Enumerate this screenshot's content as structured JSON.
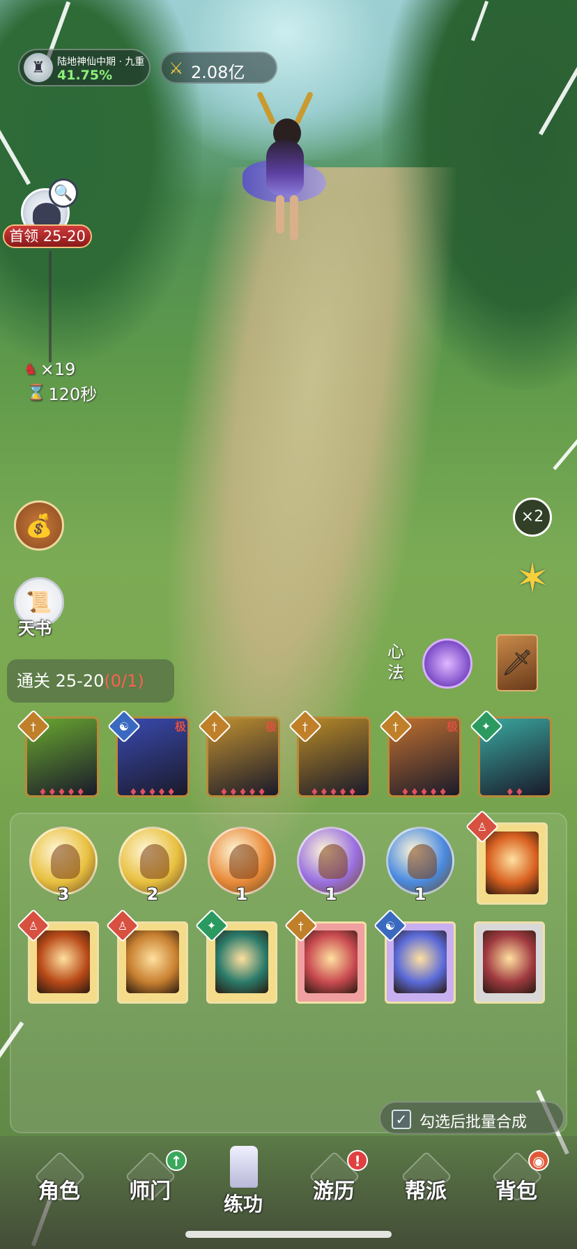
{
  "hud": {
    "rank_title": "陆地神仙中期 · 九重",
    "rank_progress": "41.75%",
    "power_value": "2.08亿",
    "power_icon": "crossed-swords-icon"
  },
  "boss": {
    "label": "首领 25-20",
    "search_icon": "magnifier-icon"
  },
  "wave": {
    "kills": "×19",
    "timer": "120秒",
    "kill_icon": "demon-head-icon",
    "timer_icon": "hourglass-icon"
  },
  "side_left": {
    "bag_icon": "money-bag-icon",
    "book_label": "天书",
    "book_icon": "scroll-icon"
  },
  "side_right": {
    "speed_label": "×2",
    "star_icon": "six-point-star-icon"
  },
  "stage": {
    "prefix": "通关 25-20",
    "count": "(0/1)"
  },
  "xinfa": {
    "label": "心法",
    "icon": "lotus-orb-icon",
    "weapon_icon": "sword-icon"
  },
  "skills": [
    {
      "type": "sword",
      "tag": "",
      "pips": "♦♦♦♦♦",
      "color": "#6aa830"
    },
    {
      "type": "yin-yang",
      "tag": "极",
      "pips": "♦♦♦♦♦",
      "color": "#3a4ab0"
    },
    {
      "type": "sword",
      "tag": "极",
      "pips": "♦♦♦♦♦",
      "color": "#c09030"
    },
    {
      "type": "sword",
      "tag": "",
      "pips": "♦♦♦♦♦",
      "color": "#b88a28"
    },
    {
      "type": "sword",
      "tag": "极",
      "pips": "♦♦♦♦♦",
      "color": "#c07030"
    },
    {
      "type": "leaf",
      "tag": "",
      "pips": "♦♦",
      "color": "#3aa8a0"
    }
  ],
  "orbs": [
    {
      "count": "3",
      "color": "#e8c040"
    },
    {
      "count": "2",
      "color": "#e8c040"
    },
    {
      "count": "1",
      "color": "#e88a3a"
    },
    {
      "count": "1",
      "color": "#9a70e0"
    },
    {
      "count": "1",
      "color": "#4a8ae0"
    }
  ],
  "cards": [
    {
      "gem": "buddha",
      "color": "#d86020"
    },
    {
      "gem": "buddha",
      "color": "#b84a18"
    },
    {
      "gem": "buddha",
      "color": "#c88030"
    },
    {
      "gem": "leaf",
      "color": "#2a7a6a"
    },
    {
      "gem": "sword",
      "color": "#c84a50"
    },
    {
      "gem": "yin-yang",
      "color": "#5a6ad8"
    },
    {
      "gem": "",
      "color": "#a03a40"
    }
  ],
  "batch": {
    "label": "勾选后批量合成",
    "checked": true
  },
  "nav": [
    {
      "label": "角色",
      "badge": ""
    },
    {
      "label": "师门",
      "badge": "up"
    },
    {
      "label": "练功",
      "badge": "",
      "active": true
    },
    {
      "label": "游历",
      "badge": "!"
    },
    {
      "label": "帮派",
      "badge": ""
    },
    {
      "label": "背包",
      "badge": "coin"
    }
  ]
}
